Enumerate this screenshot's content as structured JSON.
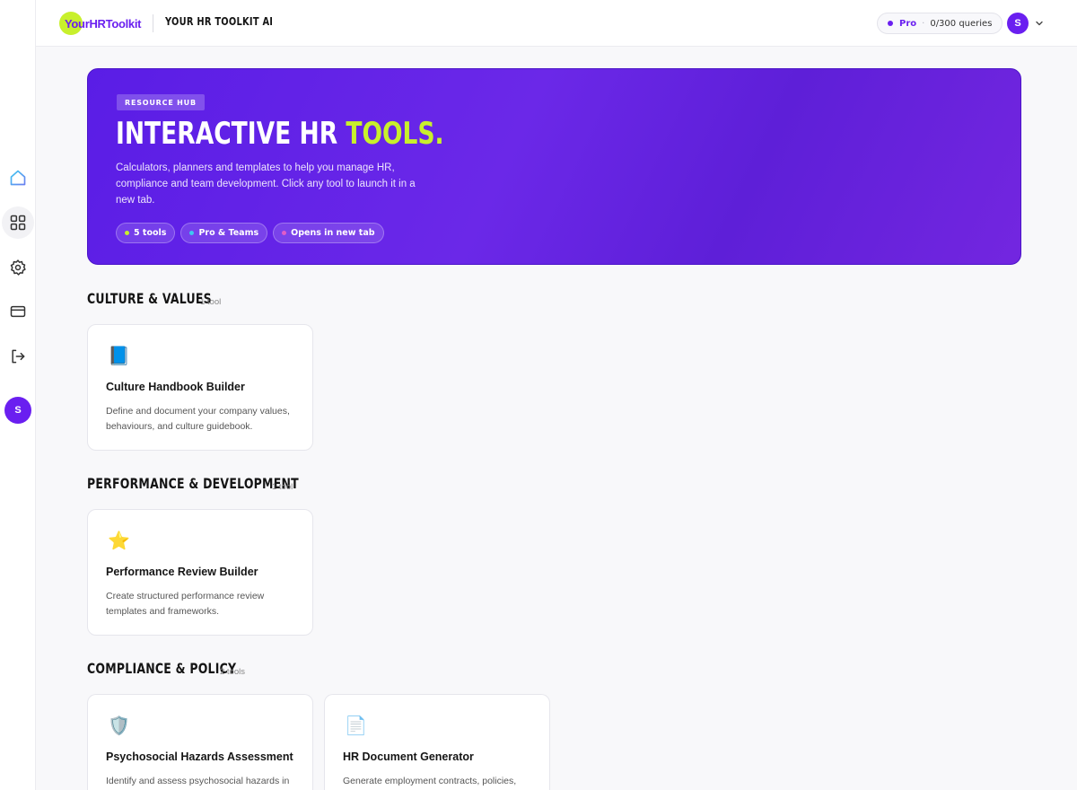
{
  "header": {
    "logo_text_1": "Your",
    "logo_text_2": "HR",
    "logo_text_3": "Toolkit",
    "app_title": "YOUR HR TOOLKIT AI",
    "plan_name": "Pro",
    "plan_sep": "·",
    "plan_usage": "0/300 queries",
    "user_initial": "S"
  },
  "sidebar": {
    "items": [
      {
        "name": "home",
        "icon": "home-icon"
      },
      {
        "name": "tools",
        "icon": "grid-icon"
      },
      {
        "name": "settings",
        "icon": "gear-icon"
      },
      {
        "name": "billing",
        "icon": "credit-card-icon"
      },
      {
        "name": "logout",
        "icon": "logout-icon"
      }
    ],
    "avatar_initial": "S"
  },
  "hero": {
    "badge": "RESOURCE HUB",
    "title_main": "INTERACTIVE HR ",
    "title_accent": "TOOLS.",
    "description": "Calculators, planners and templates to help you manage HR, compliance and team development. Click any tool to launch it in a new tab.",
    "chips": [
      {
        "label": "5 tools",
        "dot_color": "#c8f02c"
      },
      {
        "label": "Pro & Teams",
        "dot_color": "#3ec7f0"
      },
      {
        "label": "Opens in new tab",
        "dot_color": "#e05cc8"
      }
    ]
  },
  "sections": [
    {
      "title": "CULTURE & VALUES",
      "count": "1 tool",
      "tools": [
        {
          "icon": "📘",
          "title": "Culture Handbook Builder",
          "description": "Define and document your company values, behaviours, and culture guidebook."
        }
      ]
    },
    {
      "title": "PERFORMANCE & DEVELOPMENT",
      "count": "1 tool",
      "tools": [
        {
          "icon": "⭐",
          "title": "Performance Review Builder",
          "description": "Create structured performance review templates and frameworks."
        }
      ]
    },
    {
      "title": "COMPLIANCE & POLICY",
      "count": "2 tools",
      "tools": [
        {
          "icon": "🛡️",
          "title": "Psychosocial Hazards Assessment",
          "description": "Identify and assess psychosocial hazards in"
        },
        {
          "icon": "📄",
          "title": "HR Document Generator",
          "description": "Generate employment contracts, policies,"
        }
      ]
    }
  ],
  "colors": {
    "brand_purple": "#6a1ff0",
    "brand_lime": "#c8f02c"
  }
}
